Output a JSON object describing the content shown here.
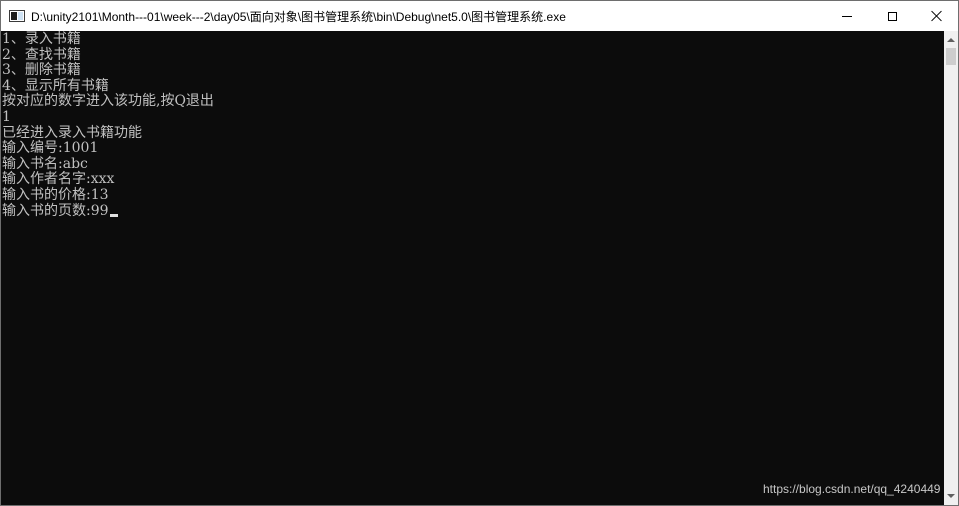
{
  "window": {
    "title": "D:\\unity2101\\Month---01\\week---2\\day05\\面向对象\\图书管理系统\\bin\\Debug\\net5.0\\图书管理系统.exe",
    "buttons": {
      "minimize": "minimize-icon",
      "maximize": "maximize-icon",
      "close": "close-icon"
    }
  },
  "console": {
    "lines": [
      "1、录入书籍",
      "2、查找书籍",
      "3、删除书籍",
      "4、显示所有书籍",
      "按对应的数字进入该功能,按Q退出",
      "1",
      "已经进入录入书籍功能",
      "输入编号:1001",
      "输入书名:abc",
      "输入作者名字:xxx",
      "输入书的价格:13",
      "输入书的页数:99"
    ],
    "text_color": "#c0c0c0",
    "background": "#0c0c0c"
  },
  "watermark": "https://blog.csdn.net/qq_4240449"
}
